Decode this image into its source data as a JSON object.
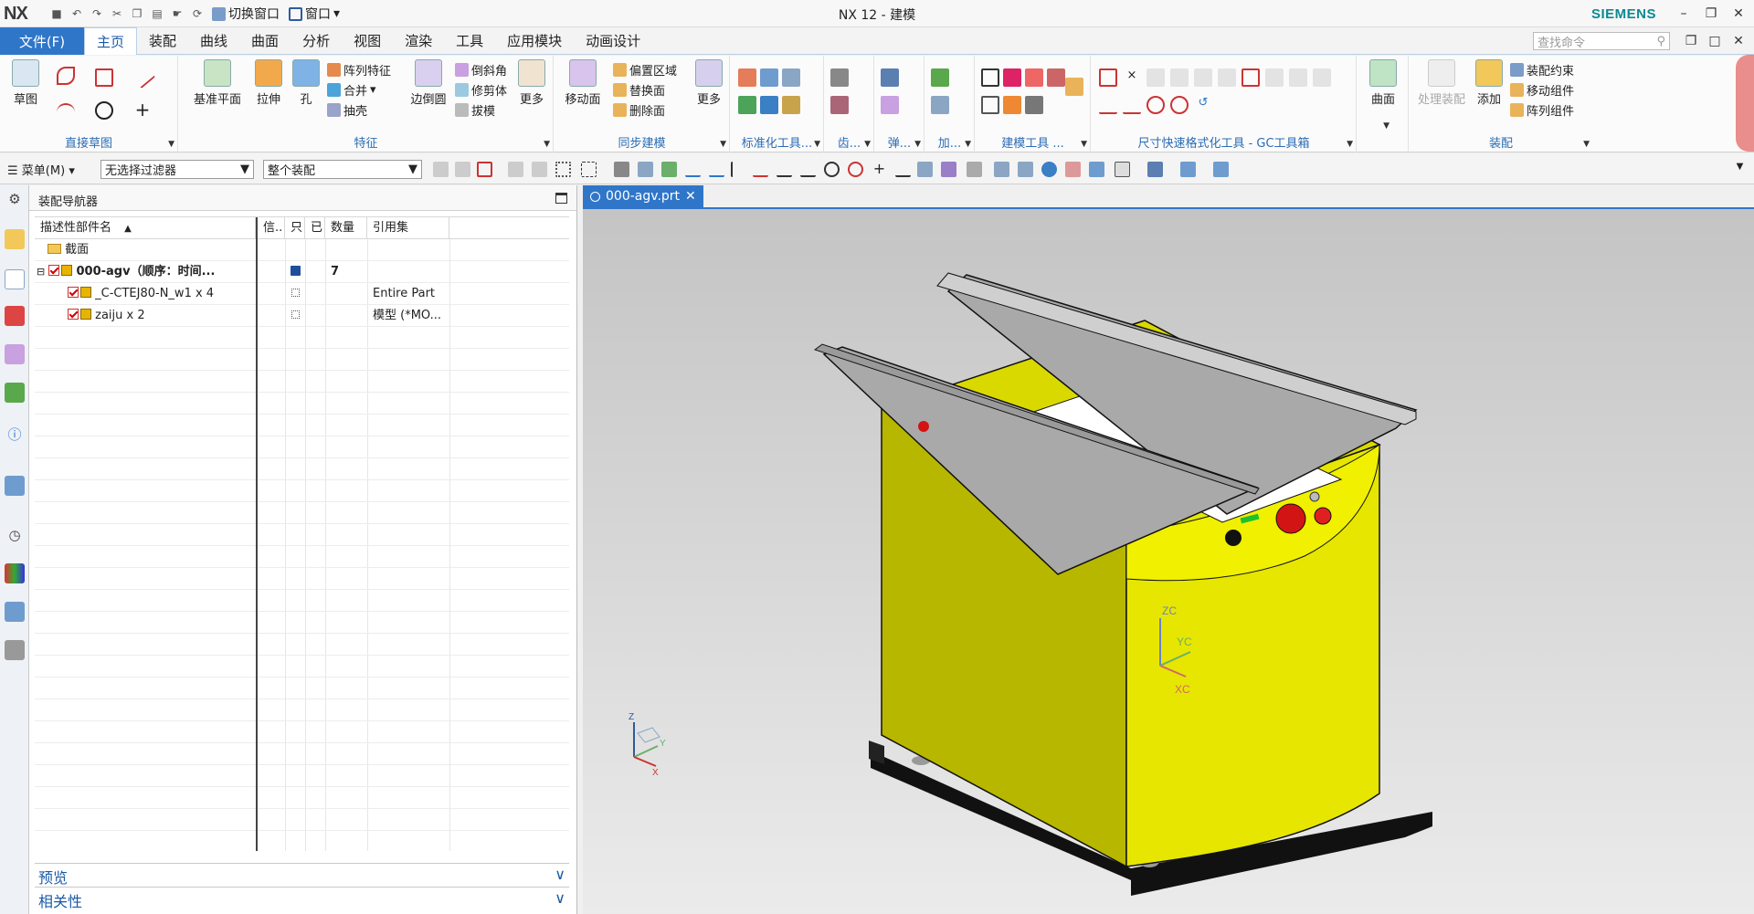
{
  "titlebar": {
    "logo": "NX",
    "quick_switch_window": "切换窗口",
    "quick_window": "窗口",
    "app_title": "NX 12 - 建模",
    "brand": "SIEMENS"
  },
  "menubar": {
    "file": "文件(F)",
    "tabs": [
      "主页",
      "装配",
      "曲线",
      "曲面",
      "分析",
      "视图",
      "渲染",
      "工具",
      "应用模块",
      "动画设计"
    ],
    "active_tab": "主页",
    "search_placeholder": "查找命令"
  },
  "ribbon": {
    "groups": [
      {
        "label": "直接草图",
        "items": [
          "草图"
        ]
      },
      {
        "label": "特征",
        "items": [
          "基准平面",
          "拉伸",
          "孔",
          "阵列特征",
          "合并",
          "抽壳",
          "边倒圆",
          "倒斜角",
          "修剪体",
          "拔模",
          "更多"
        ]
      },
      {
        "label": "同步建模",
        "items": [
          "移动面",
          "偏置区域",
          "替换面",
          "删除面",
          "更多"
        ]
      },
      {
        "label": "标准化工具...",
        "items": []
      },
      {
        "label": "齿...",
        "items": []
      },
      {
        "label": "弹...",
        "items": []
      },
      {
        "label": "加...",
        "items": []
      },
      {
        "label": "建模工具 ...",
        "items": []
      },
      {
        "label": "尺寸快速格式化工具 - GC工具箱",
        "items": []
      },
      {
        "label": "",
        "items": [
          "曲面"
        ]
      },
      {
        "label": "装配",
        "items": [
          "处理装配",
          "添加",
          "装配约束",
          "移动组件",
          "阵列组件"
        ]
      }
    ]
  },
  "selection_bar": {
    "menu": "菜单(M)",
    "filter": "无选择过滤器",
    "scope": "整个装配"
  },
  "navigator": {
    "title": "装配导航器",
    "columns": [
      "描述性部件名",
      "信..",
      "只",
      "已",
      "数量",
      "引用集"
    ],
    "rows": [
      {
        "name": "截面",
        "count": "",
        "refset": ""
      },
      {
        "name": "000-agv（顺序：时间...",
        "count": "7",
        "refset": ""
      },
      {
        "name": "_C-CTEJ80-N_w1 x 4",
        "count": "",
        "refset": "Entire Part"
      },
      {
        "name": "zaiju x 2",
        "count": "",
        "refset": "模型 (*MO..."
      }
    ],
    "preview": "预览",
    "dependency": "相关性"
  },
  "graphics": {
    "tab": "000-agv.prt",
    "axes": {
      "z": "ZC",
      "y": "YC",
      "x": "XC"
    },
    "triad": {
      "z": "Z",
      "y": "Y",
      "x": "X"
    }
  },
  "colors": {
    "accent": "#2f76c9",
    "body": "#e6e600",
    "lid": "#a9a9a9"
  }
}
